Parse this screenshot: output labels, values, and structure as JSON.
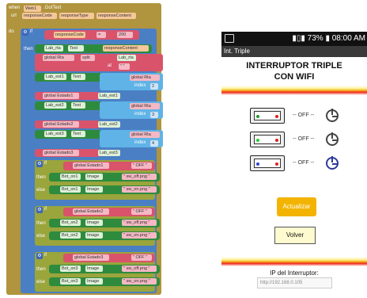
{
  "blocks": {
    "event_when": "when",
    "event_component": "Web1",
    "event_name": ".GotText",
    "param_url": "url",
    "param_response_code": "responseCode",
    "param_response_type": "responseType",
    "param_response_content": "responseContent",
    "do_label": "do",
    "if_label": "if",
    "then_label": "then",
    "else_label": "else",
    "set_label": "set",
    "get_label": "get",
    "to_label": "to",
    "at_label": "at",
    "index_label": "index",
    "cond_var": "responseCode",
    "cond_op": "=",
    "cond_value": "200",
    "set_lab_rta": "Lab_rta",
    "text_prop": "Text",
    "get_response_content": "responseContent",
    "set_global_rta": "global Rta",
    "split_text": "split",
    "text_word": "text",
    "split_source": "Lab_rta",
    "split_at": "\" \"",
    "set_lab_est1": "Lab_est1",
    "select_list": "select list item  list",
    "list_var": "global Rta",
    "idx1": "1",
    "idx2": "2",
    "idx3": "3",
    "idx4": "4",
    "idx5": "5",
    "idx6": "6",
    "set_global_est1": "global Estado1",
    "set_global_est2": "global Estado2",
    "set_global_est3": "global Estado3",
    "lab_est1_get": "Lab_est1",
    "lab_est2_get": "Lab_est2",
    "lab_est3_get": "Lab_est3",
    "set_lab_est2": "Lab_est2",
    "set_lab_est3": "Lab_est3",
    "if1_var": "global Estado1",
    "if2_var": "global Estado2",
    "if3_var": "global Estado3",
    "off_text": "\" OFF \"",
    "btn1": "Bot_on1",
    "btn2": "Bot_on2",
    "btn3": "Bot_on3",
    "image_prop": "Image",
    "img_off": "\" sw_off.png \"",
    "img_on": "\" sw_on.png \""
  },
  "phone": {
    "status_time": "08:00 AM",
    "status_battery": "73%",
    "app_bar_title": "Int. Triple",
    "title_line1": "INTERRUPTOR TRIPLE",
    "title_line2": "CON WIFI",
    "switches": [
      {
        "state_label": "-- OFF --",
        "led": "#e02020",
        "power_icon": "clock-off"
      },
      {
        "state_label": "-- OFF --",
        "led": "#22cc33",
        "power_icon": "clock-off"
      },
      {
        "state_label": "-- OFF --",
        "led": "#3040d0",
        "power_icon": "power-on"
      }
    ],
    "update_button": "Actualizar",
    "back_button": "Volver",
    "ip_label": "IP del Interruptor:",
    "ip_value": "http://192.168.0.105"
  },
  "colors": {
    "event_block": "#b0943e",
    "math_block": "#d9536b",
    "setter_block": "#2e8b3e",
    "list_block": "#5fb3e6",
    "update_button": "#f2b400"
  }
}
